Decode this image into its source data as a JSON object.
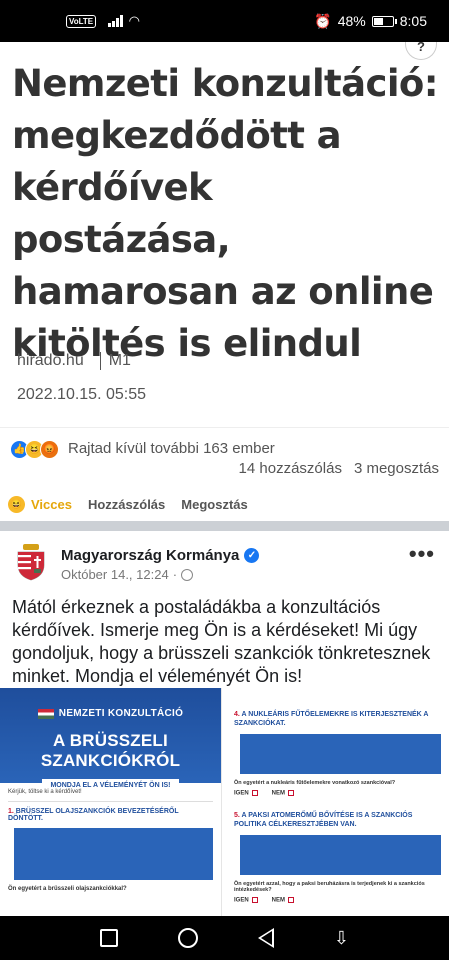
{
  "status_bar": {
    "network": "VoLTE",
    "battery": "48%",
    "battery_level": 0.48,
    "time": "8:05"
  },
  "article": {
    "headline": "Nemzeti konzultáció: megkezdődött a kérdőívek postázása, hamarosan az online kitöltés is elindul",
    "source": "hirado.hu",
    "source_channel": "M1",
    "date": "2022.10.15. 05:55",
    "scroll_indicator": "?"
  },
  "reactions": {
    "summary": "Rajtad kívül további 163 ember",
    "comments": "14 hozzászólás",
    "shares": "3 megosztás",
    "icons": [
      "like-icon",
      "haha-icon",
      "angry-icon"
    ]
  },
  "actions": {
    "reaction": "Vicces",
    "comment": "Hozzászólás",
    "share": "Megosztás"
  },
  "post": {
    "page_name": "Magyarország Kormánya",
    "verified": true,
    "time": "Október 14., 12:24",
    "text": "Mától érkeznek a postaládákba a konzultációs kérdőívek. Ismerje meg Ön is a kérdéseket! Mi úgy gondoljuk, hogy a brüsszeli szankciók tönkretesznek minket. Mondja el véleményét Ön is!"
  },
  "image_left": {
    "banner_small": "NEMZETI KONZULTÁCIÓ",
    "banner_big": "A BRÜSSZELI SZANKCIÓKRÓL",
    "button": "MONDJA EL A VÉLEMÉNYÉT ÖN IS!",
    "ask": "Kérjük, töltse ki a kérdőívet!",
    "q_number": "1.",
    "q_text": "BRÜSSZEL OLAJSZANKCIÓK BEVEZETÉSÉRŐL DÖNTÖTT.",
    "sub": "Ön egyetért a brüsszeli olajszankciókkal?"
  },
  "image_right": {
    "q4_number": "4.",
    "q4_text": "A NUKLEÁRIS FŰTŐELEMEKRE IS KITERJESZTENÉK A SZANKCIÓKAT.",
    "q4_sub": "Ön egyetért a nukleáris fűtőelemekre vonatkozó szankcióval?",
    "yes": "IGEN",
    "no": "NEM",
    "q5_number": "5.",
    "q5_text": "A PAKSI ATOMERŐMŰ BŐVÍTÉSE IS A SZANKCIÓS POLITIKA CÉLKERESZTJÉBEN VAN.",
    "q5_sub": "Ön egyetért azzal, hogy a paksi beruházásra is terjedjenek ki a szankciós intézkedések?"
  },
  "colors": {
    "facebook_blue": "#1877f2",
    "banner_blue": "#1f4e9c",
    "haha_yellow": "#f7b928",
    "angry_orange": "#e9710f"
  }
}
